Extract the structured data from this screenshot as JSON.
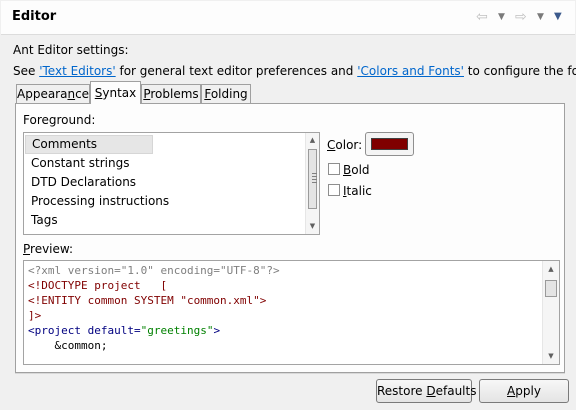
{
  "header": {
    "title": "Editor",
    "icons": [
      "back-arrow-icon",
      "forward-arrow-icon",
      "view-menu-icon"
    ]
  },
  "settings_title": "Ant Editor settings:",
  "description": {
    "prefix": "See ",
    "link1": "'Text Editors'",
    "middle": " for general text editor preferences and ",
    "link2": "'Colors and Fonts'",
    "suffix": " to configure the font."
  },
  "tabs": [
    {
      "label": "Appearance",
      "active": false
    },
    {
      "label": "Syntax",
      "active": true
    },
    {
      "label": "Problems",
      "active": false
    },
    {
      "label": "Folding",
      "active": false
    }
  ],
  "syntax": {
    "foreground_label": "Foreground:",
    "items": [
      "Comments",
      "Constant strings",
      "DTD Declarations",
      "Processing instructions",
      "Tags"
    ],
    "selected_item": "Comments",
    "color_label": "Color:",
    "color_value": "#800000",
    "bold_label": "Bold",
    "bold_checked": false,
    "italic_label": "Italic",
    "italic_checked": false,
    "preview_label": "Preview:",
    "preview_lines": [
      "<?xml version=\"1.0\" encoding=\"UTF-8\"?>",
      "<!DOCTYPE project   [",
      "<!ENTITY common SYSTEM \"common.xml\">",
      "]>",
      "<project default=\"greetings\">",
      "    &common;"
    ]
  },
  "buttons": {
    "restore_defaults": "Restore Defaults",
    "apply": "Apply"
  }
}
